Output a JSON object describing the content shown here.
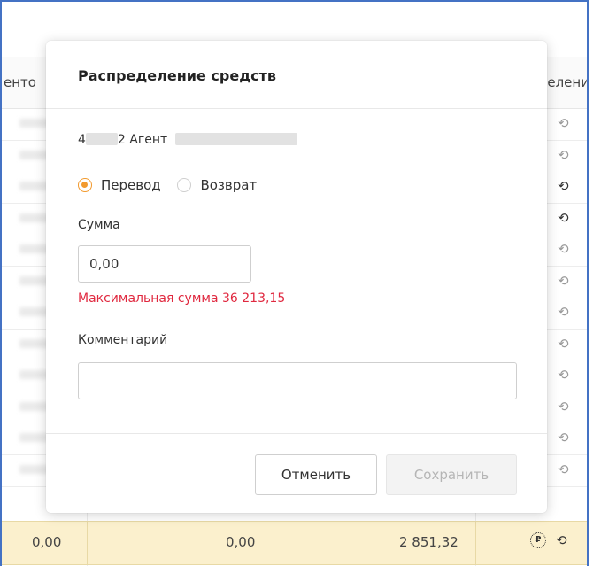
{
  "background_table": {
    "header_left": "енто",
    "header_right": "делени",
    "rows": [
      {
        "bold": false
      },
      {
        "bold": false
      },
      {
        "bold": true
      },
      {
        "bold": true
      },
      {
        "bold": false
      },
      {
        "bold": false
      },
      {
        "bold": false
      },
      {
        "bold": false
      },
      {
        "bold": false
      },
      {
        "bold": false
      },
      {
        "bold": false
      },
      {
        "bold": false
      }
    ],
    "bottom_row": {
      "col1": "0,00",
      "col2": "0,00",
      "col3": "2 851,32"
    }
  },
  "dialog": {
    "title": "Распределение средств",
    "agent_prefix": "4",
    "agent_text": "2 Агент",
    "radio_options": [
      {
        "label": "Перевод",
        "selected": true
      },
      {
        "label": "Возврат",
        "selected": false
      }
    ],
    "amount_label": "Сумма",
    "amount_value": "0,00",
    "max_amount_text": "Максимальная сумма 36 213,15",
    "comment_label": "Комментарий",
    "comment_value": "",
    "cancel_label": "Отменить",
    "save_label": "Сохранить"
  },
  "colors": {
    "accent": "#f29a2e",
    "error": "#e0283f",
    "highlight_row": "#fbf0cd",
    "frame_border": "#4472c4"
  },
  "icons": {
    "history": "clock-history-icon",
    "payment": "payment-coin-icon"
  }
}
